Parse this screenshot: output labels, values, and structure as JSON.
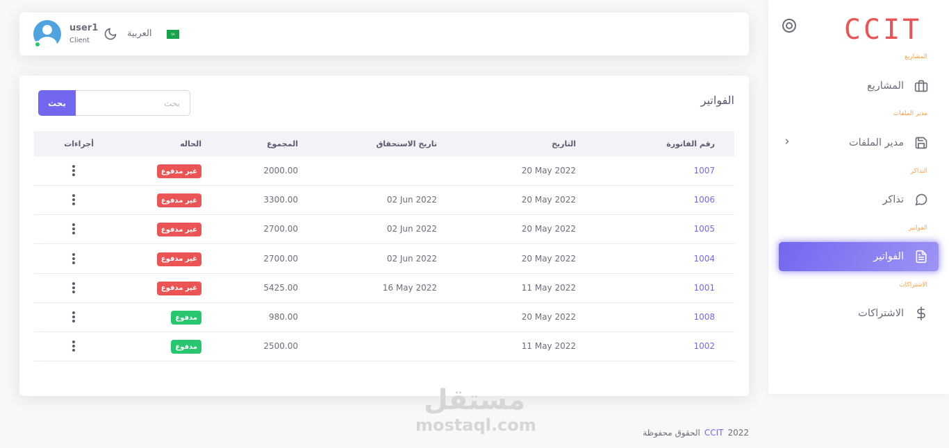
{
  "sidebar": {
    "logo": "CCIT",
    "sections": [
      {
        "label": "المشاريع",
        "item": "المشاريع",
        "icon": "briefcase-icon"
      },
      {
        "label": "مدير الملفات",
        "item": "مدير الملفات",
        "icon": "save-icon"
      },
      {
        "label": "التذاكر",
        "item": "تذاكر",
        "icon": "message-circle-icon"
      },
      {
        "label": "الفواتير",
        "item": "الفواتير",
        "icon": "file-text-icon"
      },
      {
        "label": "الاشتراكات",
        "item": "الاشتراكات",
        "icon": "dollar-sign-icon"
      }
    ],
    "active": "الفواتير"
  },
  "header": {
    "user_name": "user1",
    "user_role": "Client",
    "language": "العربية",
    "flag_text": "SA"
  },
  "invoices": {
    "title": "الفواتير",
    "search_button": "بحث",
    "search_placeholder": "بحث",
    "columns": [
      "رقم الفاتورة",
      "التاريخ",
      "تاريخ الاستحقاق",
      "المجموع",
      "الحاله",
      "أجراءات"
    ],
    "rows": [
      {
        "number": "1007",
        "date": "20 May 2022",
        "due": "",
        "total": "2000.00",
        "status": "غير مدفوع",
        "paid": false
      },
      {
        "number": "1006",
        "date": "20 May 2022",
        "due": "02 Jun 2022",
        "total": "3300.00",
        "status": "غير مدفوع",
        "paid": false
      },
      {
        "number": "1005",
        "date": "20 May 2022",
        "due": "02 Jun 2022",
        "total": "2700.00",
        "status": "غير مدفوع",
        "paid": false
      },
      {
        "number": "1004",
        "date": "20 May 2022",
        "due": "02 Jun 2022",
        "total": "2700.00",
        "status": "غير مدفوع",
        "paid": false
      },
      {
        "number": "1001",
        "date": "11 May 2022",
        "due": "16 May 2022",
        "total": "5425.00",
        "status": "غير مدفوع",
        "paid": false
      },
      {
        "number": "1008",
        "date": "20 May 2022",
        "due": "",
        "total": "980.00",
        "status": "مدفوع",
        "paid": true
      },
      {
        "number": "1002",
        "date": "11 May 2022",
        "due": "",
        "total": "2500.00",
        "status": "مدفوع",
        "paid": true
      }
    ]
  },
  "footer": {
    "year": "2022",
    "brand": "CCIT",
    "rights": "الحقوق محفوظة"
  },
  "watermark": {
    "arabic": "مستقل",
    "latin": "mostaql.com"
  },
  "colors": {
    "primary": "#7367f0",
    "danger": "#ea5455",
    "success": "#28c76f",
    "warning": "#ff9f43"
  }
}
